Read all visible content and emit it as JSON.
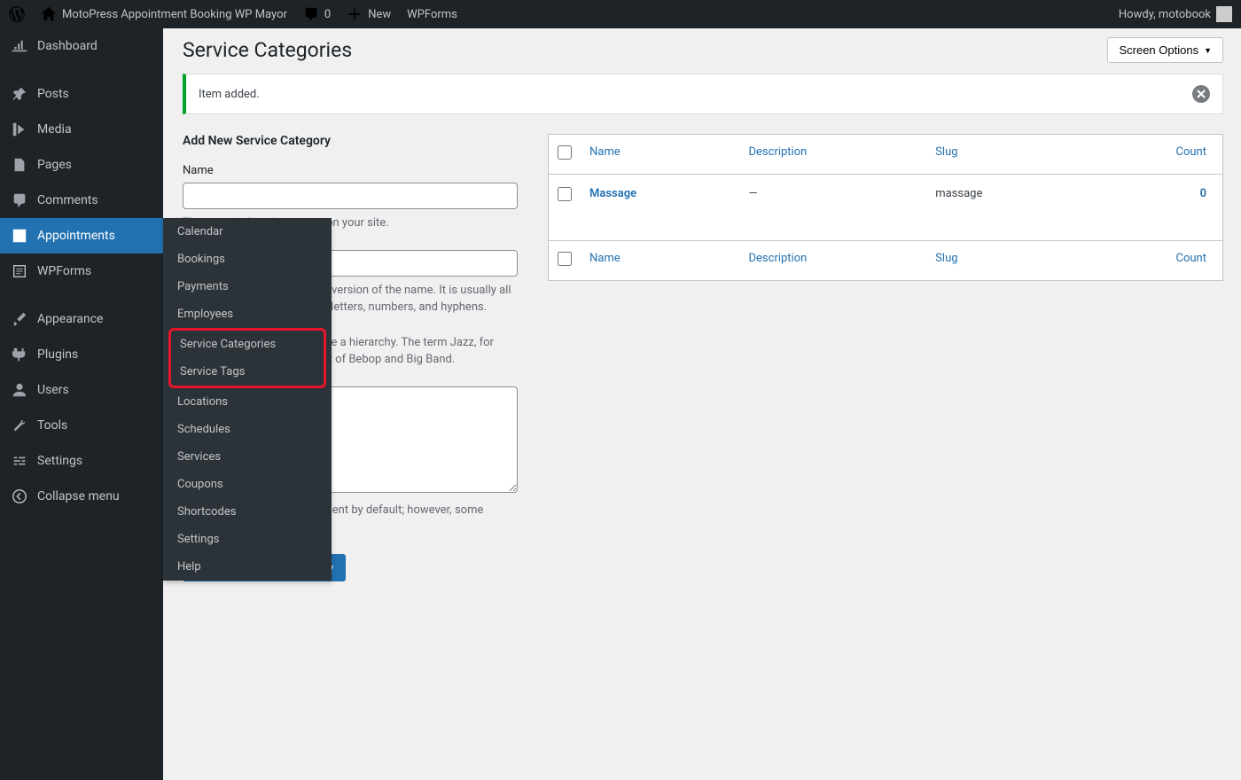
{
  "adminbar": {
    "site_title": "MotoPress Appointment Booking WP Mayor",
    "comments_count": "0",
    "new_label": "New",
    "wpforms_label": "WPForms",
    "howdy": "Howdy, motobook"
  },
  "sidebar": {
    "items": [
      {
        "label": "Dashboard"
      },
      {
        "label": "Posts"
      },
      {
        "label": "Media"
      },
      {
        "label": "Pages"
      },
      {
        "label": "Comments"
      },
      {
        "label": "Appointments"
      },
      {
        "label": "WPForms"
      },
      {
        "label": "Appearance"
      },
      {
        "label": "Plugins"
      },
      {
        "label": "Users"
      },
      {
        "label": "Tools"
      },
      {
        "label": "Settings"
      },
      {
        "label": "Collapse menu"
      }
    ],
    "flyout": [
      "Calendar",
      "Bookings",
      "Payments",
      "Employees",
      "Service Categories",
      "Service Tags",
      "Locations",
      "Schedules",
      "Services",
      "Coupons",
      "Shortcodes",
      "Settings",
      "Help"
    ]
  },
  "page": {
    "title": "Service Categories",
    "screen_options": "Screen Options",
    "notice": "Item added."
  },
  "form": {
    "heading": "Add New Service Category",
    "name_label": "Name",
    "name_desc": "The name is how it appears on your site.",
    "slug_desc": "The \"slug\" is the URL-friendly version of the name. It is usually all lowercase and contains only letters, numbers, and hyphens.",
    "parent_desc": "Assign a parent term to create a hierarchy. The term Jazz, for example, would be the parent of Bebop and Big Band.",
    "desc_desc": "The description is not prominent by default; however, some themes may show it.",
    "submit": "Add New Service Category"
  },
  "table": {
    "headers": {
      "name": "Name",
      "description": "Description",
      "slug": "Slug",
      "count": "Count"
    },
    "rows": [
      {
        "name": "Massage",
        "description": "—",
        "slug": "massage",
        "count": "0"
      }
    ]
  }
}
